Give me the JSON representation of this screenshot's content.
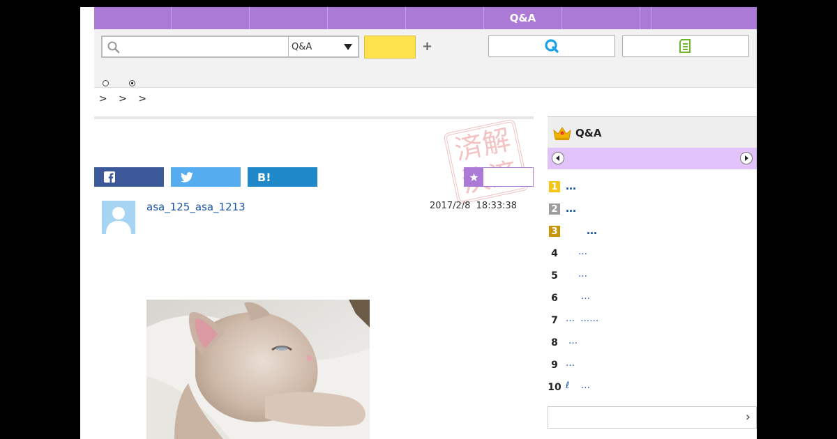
{
  "nav": {
    "items": [
      "",
      "",
      "",
      "",
      "",
      "Q&A",
      "",
      "",
      ""
    ]
  },
  "search": {
    "placeholder": "",
    "value": "",
    "scope": "Q&A",
    "plus": "+"
  },
  "breadcrumb": "> > >",
  "share": {
    "facebook_icon": "f",
    "twitter_icon": "twitter-bird",
    "hatena_label": "B!"
  },
  "fav_star": "★",
  "stamp": [
    "済",
    "解",
    "決",
    "済"
  ],
  "post": {
    "username": "asa_125_asa_1213",
    "timestamp": "2017/2/8  18:33:38"
  },
  "ranking": {
    "title": "Q&A",
    "items": [
      {
        "rank": "1",
        "style": "gold",
        "text": "…",
        "indent": 26
      },
      {
        "rank": "2",
        "style": "silver",
        "text": "…",
        "indent": 26
      },
      {
        "rank": "3",
        "style": "bronze",
        "text": "…",
        "indent": 56
      },
      {
        "rank": "4",
        "style": "plain",
        "text": "…",
        "indent": 44
      },
      {
        "rank": "5",
        "style": "plain",
        "text": "…",
        "indent": 44
      },
      {
        "rank": "6",
        "style": "plain",
        "text": "…",
        "indent": 48
      },
      {
        "rank": "7",
        "style": "plain",
        "text": "…  ……",
        "indent": 26
      },
      {
        "rank": "8",
        "style": "plain",
        "text": "…",
        "indent": 30
      },
      {
        "rank": "9",
        "style": "plain",
        "text": "…",
        "indent": 26
      },
      {
        "rank": "10",
        "style": "plain",
        "text": "ℓ    …",
        "indent": 26
      }
    ],
    "more_chevron": "›"
  },
  "colors": {
    "nav": "#aa7ad6",
    "pager": "#e1c3fa",
    "search_button": "#ffe34d"
  }
}
